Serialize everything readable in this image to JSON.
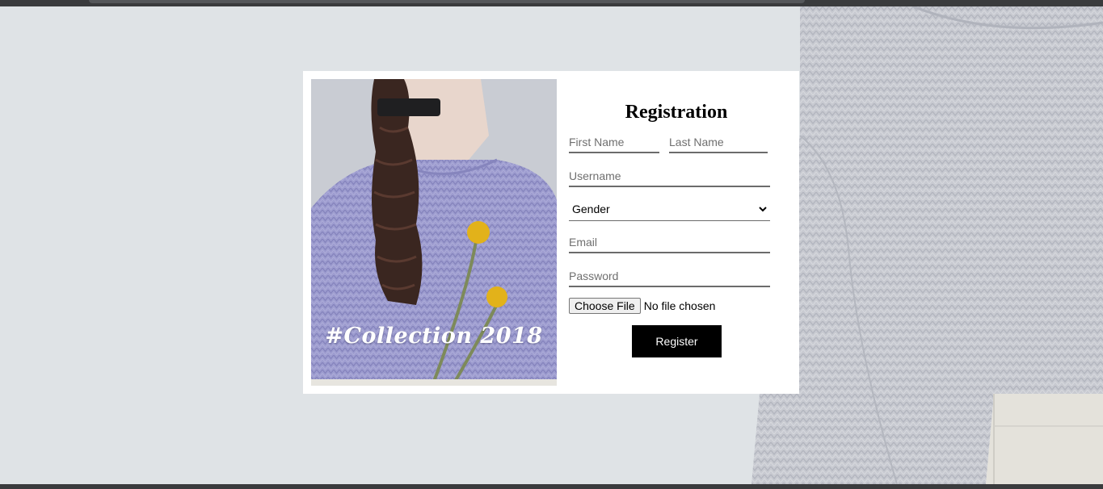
{
  "form": {
    "title": "Registration",
    "first_name_placeholder": "First Name",
    "last_name_placeholder": "Last Name",
    "username_placeholder": "Username",
    "gender_selected": "Gender",
    "email_placeholder": "Email",
    "password_placeholder": "Password",
    "file_button_label": "Choose File",
    "file_status": "No file chosen",
    "register_label": "Register"
  },
  "photo": {
    "caption": "#Collection 2018"
  },
  "colors": {
    "page_background": "#dfe3e6",
    "card_background": "#ffffff",
    "sweater_lilac": "#9d9ccf",
    "button_black": "#000000",
    "flower_yellow": "#e2b21a"
  },
  "icons": {
    "dropdown": "chevron-down-icon"
  }
}
